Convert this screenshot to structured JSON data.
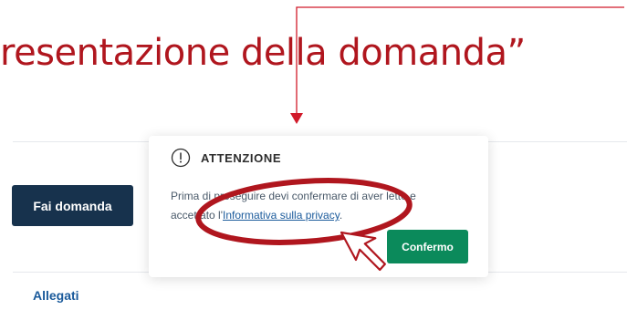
{
  "slide": {
    "title": "resentazione della domanda”"
  },
  "page": {
    "apply_button": "Fai domanda",
    "attachments_link": "Allegati"
  },
  "popover": {
    "title": "ATTENZIONE",
    "icon": "info-circle-icon",
    "body_part1": "Prima di proseguire devi confermare di aver letto e accettato l'",
    "privacy_link": "Informativa sulla privacy",
    "body_part2": ".",
    "confirm_button": "Confermo"
  },
  "annotations": {
    "icons": [
      "arrow-down-icon",
      "highlight-ellipse",
      "cursor-pointer-icon"
    ],
    "colors": {
      "annotation_red": "#b0161e",
      "primary_dark": "#17324d",
      "confirm_green": "#0b8a5b",
      "link_blue": "#1a5a9b"
    }
  }
}
